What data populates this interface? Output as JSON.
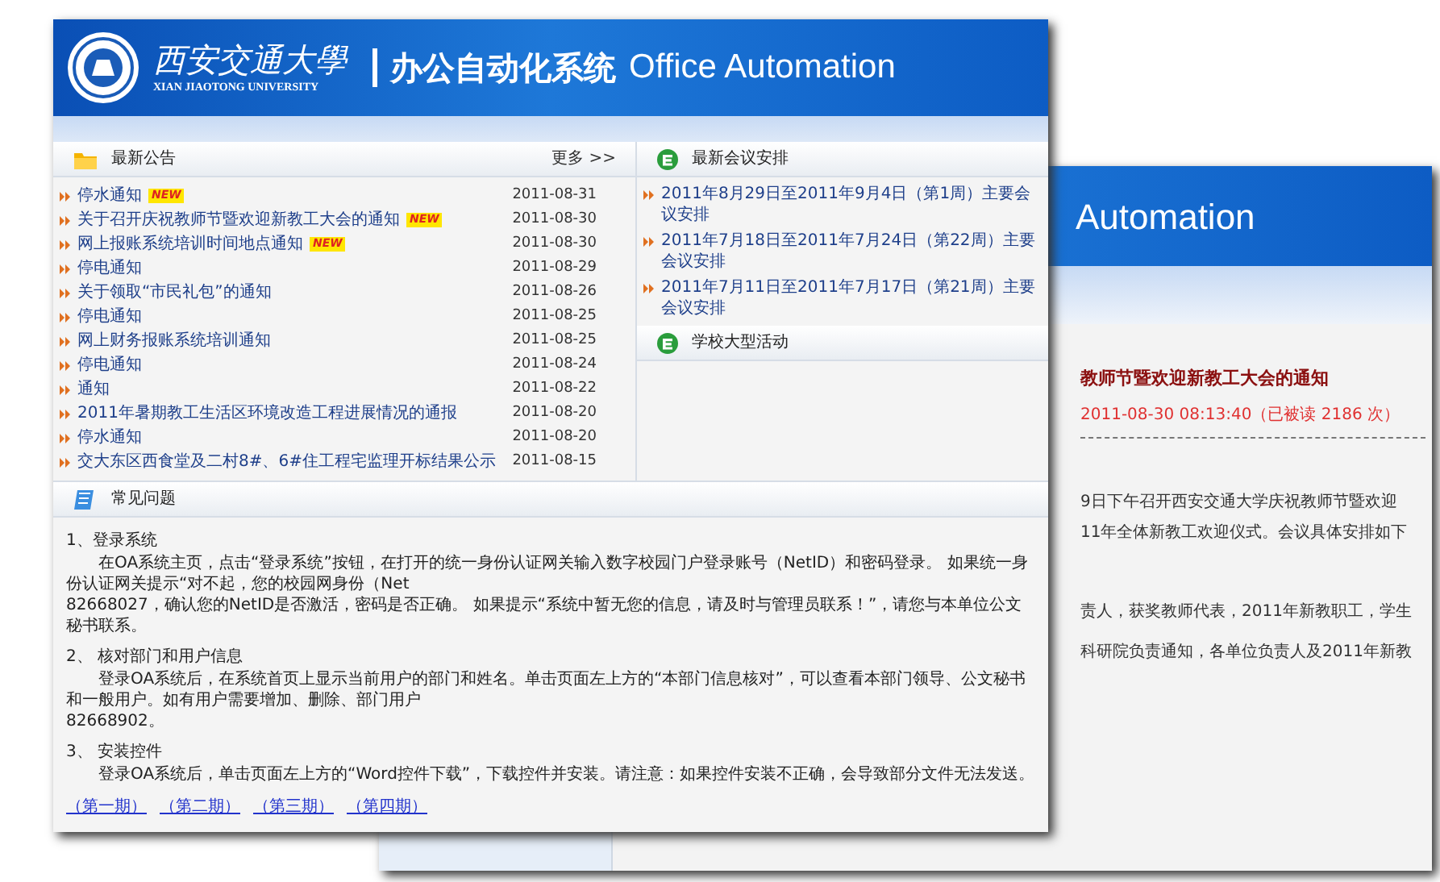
{
  "back_window": {
    "header_title": "Automation",
    "article": {
      "title": "教师节暨欢迎新教工大会的通知",
      "meta": "2011-08-30 08:13:40（已被读 2186 次）",
      "paragraphs": [
        "9日下午召开西安交通大学庆祝教师节暨欢迎",
        "11年全体新教工欢迎仪式。会议具体安排如下",
        "责人，获奖教师代表，2011年新教职工，学生",
        "科研院负责通知，各单位负责人及2011年新教"
      ]
    }
  },
  "front_window": {
    "header": {
      "school_name": "西安交通大學",
      "school_name_en": "XIAN JIAOTONG UNIVERSITY",
      "system_name": "办公自动化系统",
      "system_name_en": "Office Automation"
    },
    "notices": {
      "title": "最新公告",
      "more": "更多 >>",
      "items": [
        {
          "title": "停水通知",
          "badge": "NEW",
          "date": "2011-08-31"
        },
        {
          "title": "关于召开庆祝教师节暨欢迎新教工大会的通知",
          "badge": "NEW",
          "date": "2011-08-30"
        },
        {
          "title": "网上报账系统培训时间地点通知",
          "badge": "NEW",
          "date": "2011-08-30"
        },
        {
          "title": "停电通知",
          "date": "2011-08-29"
        },
        {
          "title": "关于领取“市民礼包”的通知",
          "date": "2011-08-26"
        },
        {
          "title": "停电通知",
          "date": "2011-08-25"
        },
        {
          "title": "网上财务报账系统培训通知",
          "date": "2011-08-25"
        },
        {
          "title": "停电通知",
          "date": "2011-08-24"
        },
        {
          "title": "通知",
          "date": "2011-08-22"
        },
        {
          "title": "2011年暑期教工生活区环境改造工程进展情况的通报",
          "date": "2011-08-20"
        },
        {
          "title": "停水通知",
          "date": "2011-08-20"
        },
        {
          "title": "交大东区西食堂及二村8#、6#住工程宅监理开标结果公示",
          "date": "2011-08-15"
        }
      ]
    },
    "meetings": {
      "title": "最新会议安排",
      "items": [
        "2011年8月29日至2011年9月4日（第1周）主要会议安排",
        "2011年7月18日至2011年7月24日（第22周）主要会议安排",
        "2011年7月11日至2011年7月17日（第21周）主要会议安排"
      ]
    },
    "activities": {
      "title": "学校大型活动"
    },
    "faq": {
      "title": "常见问题",
      "sections": [
        {
          "heading": "1、登录系统",
          "paragraphs": [
            "在OA系统主页，点击“登录系统”按钮，在打开的统一身份认证网关输入数字校园门户登录账号（NetID）和密码登录。 如果统一身份认证网关提示“对不起，您的校园网身份（Net",
            "82668027，确认您的NetID是否激活，密码是否正确。 如果提示“系统中暂无您的信息，请及时与管理员联系！”，请您与本单位公文秘书联系。"
          ]
        },
        {
          "heading": "2、 核对部门和用户信息",
          "paragraphs": [
            "登录OA系统后，在系统首页上显示当前用户的部门和姓名。单击页面左上方的“本部门信息核对”，可以查看本部门领导、公文秘书和一般用户。如有用户需要增加、删除、部门用户",
            "82668902。"
          ]
        },
        {
          "heading": "3、 安装控件",
          "paragraphs": [
            "登录OA系统后，单击页面左上方的“Word控件下载”，下载控件并安装。请注意：如果控件安装不正确，会导致部分文件无法发送。"
          ]
        }
      ],
      "links": [
        "（第一期）",
        "（第二期）",
        "（第三期）",
        "（第四期）"
      ]
    }
  }
}
